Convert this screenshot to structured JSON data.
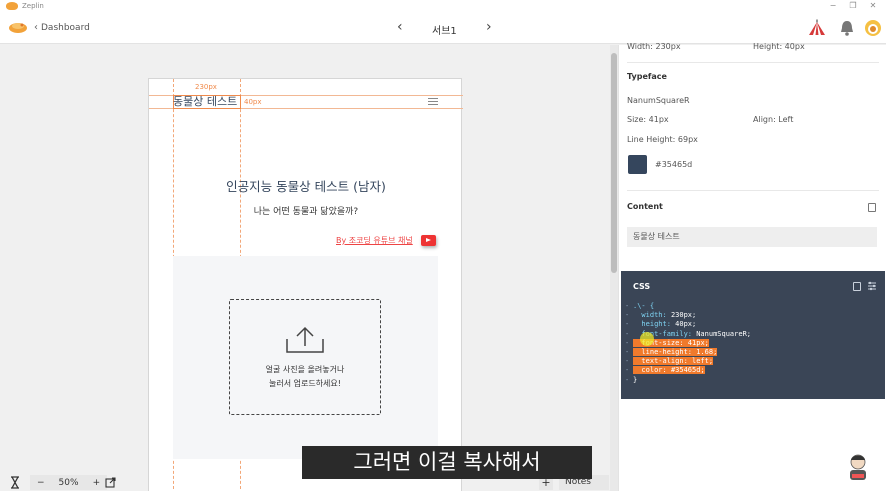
{
  "app": {
    "name": "Zeplin"
  },
  "toolbar": {
    "back_label": "Dashboard",
    "screen_name": "서브1"
  },
  "artboard": {
    "width_label": "230px",
    "height_label": "40px",
    "header_title": "동물상 테스트",
    "heading": "인공지능 동물상 테스트 (남자)",
    "subheading": "나는 어떤 동물과 닮았을까?",
    "link_text": "By 조코딩 유튜브 채널",
    "upload_line1": "얼굴 사진을 올려놓거나",
    "upload_line2": "눌러서 업로드하세요!"
  },
  "subtitle": "그러면 이걸 복사해서",
  "bottom": {
    "zoom": "50%",
    "minus": "−",
    "plus": "+",
    "notes": "Notes"
  },
  "inspector": {
    "width_text": "Width: 230px",
    "height_text": "Height: 40px",
    "typeface_label": "Typeface",
    "font_name": "NanumSquareR",
    "size_text": "Size: 41px",
    "align_text": "Align: Left",
    "line_height_text": "Line Height: 69px",
    "color_hex": "#35465d",
    "content_label": "Content",
    "content_value": "동물상 테스트",
    "css_label": "CSS"
  },
  "css_lines": [
    {
      "key": ".\\- {",
      "value": ""
    },
    {
      "key": "  width: ",
      "value": "230px;"
    },
    {
      "key": "  height: ",
      "value": "40px;"
    },
    {
      "key": "  font-family: ",
      "value": "NanumSquareR;"
    },
    {
      "key": "  font-size: ",
      "value": "41px;"
    },
    {
      "key": "  line-height: ",
      "value": "1.68;"
    },
    {
      "key": "  text-align: ",
      "value": "left;"
    },
    {
      "key": "  color: ",
      "value": "#35465d;"
    },
    {
      "key": "}",
      "value": ""
    }
  ],
  "colors": {
    "accent": "#f08a4b",
    "css_bg": "#3a4556",
    "text_swatch": "#35465d",
    "highlight": "#f07a2c"
  }
}
